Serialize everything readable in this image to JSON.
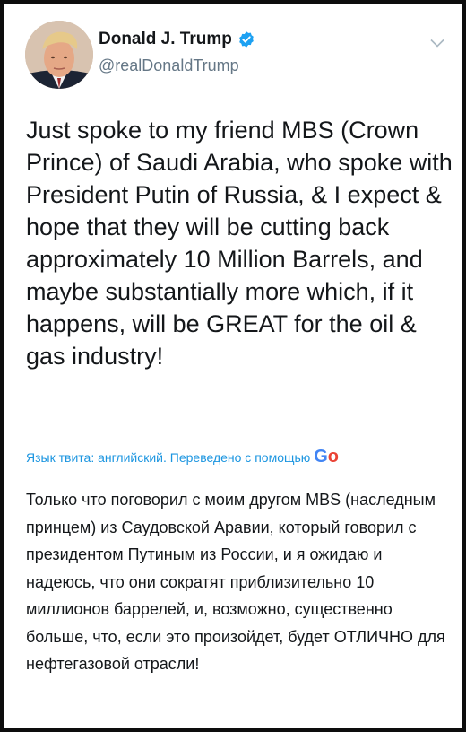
{
  "user": {
    "name": "Donald J. Trump",
    "handle": "@realDonaldTrump",
    "avatar": "profile-photo",
    "verified_icon": "verified-badge-icon",
    "menu_icon": "chevron-down-icon"
  },
  "tweet": {
    "text": "Just spoke to my friend MBS (Crown Prince) of Saudi Arabia, who spoke with President Putin of Russia, & I expect & hope that they will be cutting back approximately 10 Million Barrels, and maybe substantially more which, if it happens, will be GREAT for the oil & gas industry!"
  },
  "translation": {
    "label": "Язык твита: английский. Переведено с помощью",
    "provider_visible": "Go",
    "text": "Только что поговорил с моим другом MBS (наследным принцем) из Саудовской Аравии, который говорил с президентом Путиным из России, и я ожидаю и надеюсь, что они сократят приблизительно 10 миллионов баррелей, и, возможно, существенно больше, что, если это произойдет, будет ОТЛИЧНО для нефтегазовой отрасли!"
  },
  "colors": {
    "link": "#1b95e0",
    "verified": "#1da1f2",
    "text": "#14171a",
    "secondary": "#657786",
    "page_border": "#0d0d0d"
  }
}
